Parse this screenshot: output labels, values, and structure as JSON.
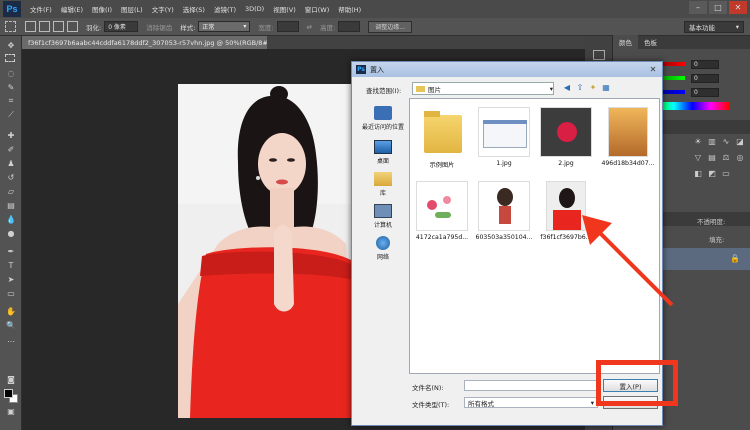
{
  "app": {
    "logo": "Ps",
    "title": "Adobe Photoshop"
  },
  "menu": [
    "文件(F)",
    "编辑(E)",
    "图像(I)",
    "图层(L)",
    "文字(Y)",
    "选择(S)",
    "滤镜(T)",
    "3D(D)",
    "视图(V)",
    "窗口(W)",
    "帮助(H)"
  ],
  "window_controls": {
    "minimize": "–",
    "restore": "□",
    "close": "✕"
  },
  "options": {
    "feather_label": "羽化:",
    "feather_value": "0 像素",
    "antialias_label": "消除锯齿",
    "style_label": "样式:",
    "style_value": "正常",
    "width_label": "宽度:",
    "height_label": "高度:",
    "refine_edge_label": "调整边缘...",
    "workspace_value": "基本功能"
  },
  "document": {
    "tab_title": "f36f1cf3697b6aabc44cddfa6178ddf2_307053-r57vhn.jpg @ 50%(RGB/8#)",
    "close": "×"
  },
  "panels": {
    "color_tab": "颜色",
    "swatches_tab": "色板",
    "rgb_values": [
      "0",
      "0",
      "0"
    ],
    "opacity_label": "不透明度:",
    "fill_label": "填充:",
    "lock_icon": "lock-icon"
  },
  "dialog": {
    "title": "置入",
    "close": "✕",
    "look_in_label": "查找范围(I):",
    "look_in_value": "图片",
    "places": [
      {
        "label": "最近访问的位置",
        "icon": "recent-places-icon"
      },
      {
        "label": "桌面",
        "icon": "desktop-icon"
      },
      {
        "label": "库",
        "icon": "libraries-icon"
      },
      {
        "label": "计算机",
        "icon": "computer-icon"
      },
      {
        "label": "网络",
        "icon": "network-icon"
      }
    ],
    "files": [
      {
        "label": "示例图片",
        "type": "folder"
      },
      {
        "label": "1.jpg",
        "type": "screenshot"
      },
      {
        "label": "2.jpg",
        "type": "lantern"
      },
      {
        "label": "496d18b34d07...",
        "type": "sunset"
      },
      {
        "label": "4172ca1a795d...",
        "type": "flowers"
      },
      {
        "label": "603503a350104...",
        "type": "cartoon-girl"
      },
      {
        "label": "f36f1cf3697b6...",
        "type": "portrait-selected"
      }
    ],
    "filename_label": "文件名(N):",
    "filename_value": "",
    "filetype_label": "文件类型(T):",
    "filetype_value": "所有格式",
    "place_button": "置入(P)",
    "cancel_button": ""
  },
  "colors": {
    "annotation_red": "#f0361c",
    "dress_red": "#e8261f",
    "dialog_title_blue": "#a9c1e2"
  }
}
